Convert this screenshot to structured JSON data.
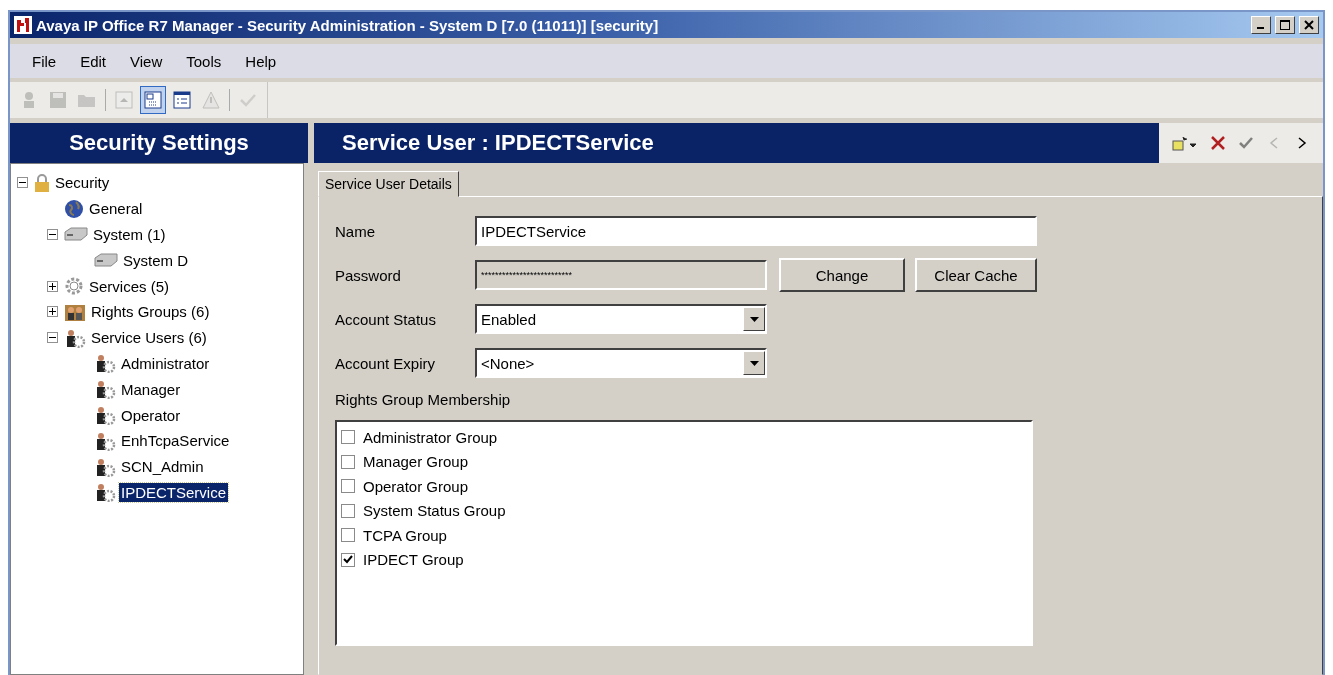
{
  "window": {
    "title": "Avaya IP Office R7 Manager - Security Administration - System D [7.0 (11011)] [security]"
  },
  "menu": [
    "File",
    "Edit",
    "View",
    "Tools",
    "Help"
  ],
  "toolbar": [
    {
      "kind": "person",
      "disabled": true,
      "pressed": false
    },
    {
      "kind": "save",
      "disabled": true,
      "pressed": false
    },
    {
      "kind": "open",
      "disabled": true,
      "pressed": false
    },
    {
      "kind": "up",
      "disabled": true,
      "pressed": false
    },
    {
      "kind": "tree",
      "disabled": false,
      "pressed": true
    },
    {
      "kind": "details",
      "disabled": false,
      "pressed": false
    },
    {
      "kind": "warning",
      "disabled": true,
      "pressed": false
    },
    {
      "kind": "check",
      "disabled": true,
      "pressed": false
    }
  ],
  "sidebar": {
    "title": "Security Settings",
    "tree": [
      {
        "label": "Security",
        "kind": "lock",
        "expanded": true,
        "selected": false,
        "children": [
          {
            "label": "General",
            "kind": "globe",
            "selected": false
          },
          {
            "label": "System (1)",
            "kind": "server",
            "expanded": true,
            "selected": false,
            "children": [
              {
                "label": "System D",
                "kind": "server",
                "selected": false
              }
            ]
          },
          {
            "label": "Services (5)",
            "kind": "gear",
            "expanded": false,
            "selected": false
          },
          {
            "label": "Rights Groups (6)",
            "kind": "group",
            "expanded": false,
            "selected": false
          },
          {
            "label": "Service Users (6)",
            "kind": "user",
            "expanded": true,
            "selected": false,
            "children": [
              {
                "label": "Administrator",
                "kind": "user",
                "selected": false
              },
              {
                "label": "Manager",
                "kind": "user",
                "selected": false
              },
              {
                "label": "Operator",
                "kind": "user",
                "selected": false
              },
              {
                "label": "EnhTcpaService",
                "kind": "user",
                "selected": false
              },
              {
                "label": "SCN_Admin",
                "kind": "user",
                "selected": false
              },
              {
                "label": "IPDECTService",
                "kind": "user",
                "selected": true
              }
            ]
          }
        ]
      }
    ]
  },
  "panel": {
    "title": "Service User :  IPDECTService",
    "actions": [
      {
        "kind": "new",
        "disabled": false
      },
      {
        "kind": "delete",
        "disabled": false
      },
      {
        "kind": "check",
        "disabled": true
      },
      {
        "kind": "prev",
        "disabled": true
      },
      {
        "kind": "next",
        "disabled": false
      }
    ],
    "tabs": [
      {
        "label": "Service User Details",
        "selected": true
      }
    ],
    "form": {
      "name": {
        "label": "Name",
        "value": "IPDECTService"
      },
      "password": {
        "label": "Password",
        "value": "**************************",
        "disabled": true
      },
      "buttons": [
        "Change",
        "Clear Cache"
      ],
      "account_status": {
        "label": "Account Status",
        "value": "Enabled"
      },
      "account_expiry": {
        "label": "Account Expiry",
        "value": "<None>"
      },
      "rights_label": "Rights Group Membership",
      "rights_groups": [
        {
          "label": "Administrator Group",
          "checked": false
        },
        {
          "label": "Manager Group",
          "checked": false
        },
        {
          "label": "Operator Group",
          "checked": false
        },
        {
          "label": "System Status Group",
          "checked": false
        },
        {
          "label": "TCPA Group",
          "checked": false
        },
        {
          "label": "IPDECT Group",
          "checked": true
        }
      ]
    }
  }
}
